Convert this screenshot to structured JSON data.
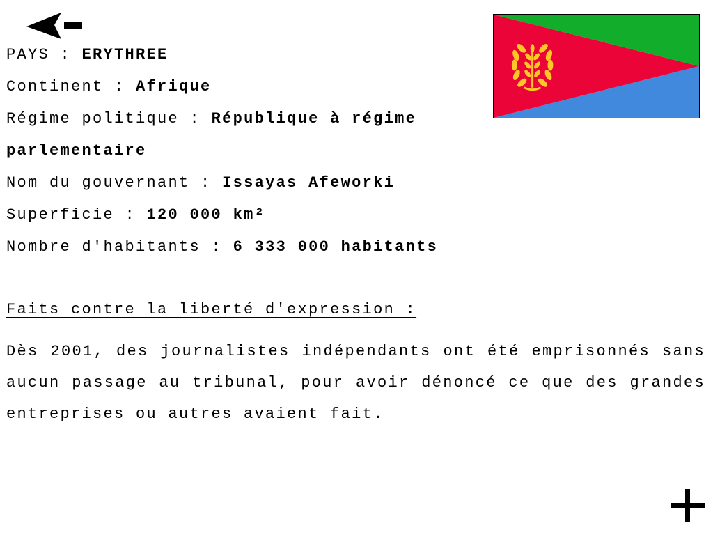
{
  "country": {
    "label": "PAYS :",
    "value": "ERYTHREE"
  },
  "continent": {
    "label": "Continent :",
    "value": "Afrique"
  },
  "regime": {
    "label": "Régime politique :",
    "value_line1": "République à régime",
    "value_line2": "parlementaire"
  },
  "leader": {
    "label": "Nom du gouvernant :",
    "value": "Issayas Afeworki"
  },
  "area": {
    "label": "Superficie :",
    "value": "120 000 km²"
  },
  "population": {
    "label": "Nombre d'habitants :",
    "value": "6 333 000 habitants"
  },
  "facts": {
    "heading": "Faits contre la liberté d'expression :",
    "text": "Dès 2001, des journalistes indépendants ont été emprisonnés sans aucun passage au tribunal, pour avoir dénoncé ce que des grandes entreprises ou autres avaient fait."
  },
  "icons": {
    "back": "arrow-left-icon",
    "more": "plus-icon",
    "flag": "eritrea-flag"
  },
  "colors": {
    "flag_green": "#12AD2B",
    "flag_red": "#EA0437",
    "flag_blue": "#4189DD",
    "flag_emblem": "#FFC726"
  }
}
